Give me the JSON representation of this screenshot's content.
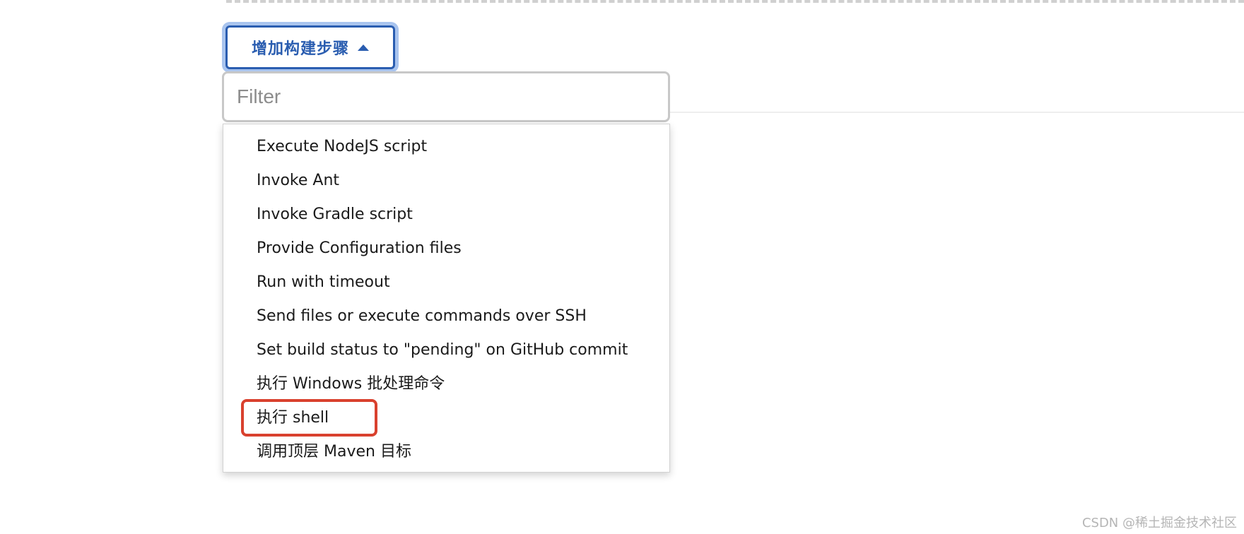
{
  "add_step_button": {
    "label": "增加构建步骤",
    "icon": "caret-up-icon"
  },
  "filter": {
    "placeholder": "Filter",
    "value": ""
  },
  "menu": {
    "items": [
      {
        "label": "Execute NodeJS script"
      },
      {
        "label": "Invoke Ant"
      },
      {
        "label": "Invoke Gradle script"
      },
      {
        "label": "Provide Configuration files"
      },
      {
        "label": "Run with timeout"
      },
      {
        "label": "Send files or execute commands over SSH"
      },
      {
        "label": "Set build status to \"pending\" on GitHub commit"
      },
      {
        "label": "执行 Windows 批处理命令"
      },
      {
        "label": "执行 shell"
      },
      {
        "label": "调用顶层 Maven 目标"
      }
    ],
    "highlighted_item": "执行 shell"
  },
  "colors": {
    "accent": "#2a5db0",
    "highlight": "#d9412e"
  },
  "watermark": {
    "text": "CSDN @稀土掘金技术社区"
  }
}
